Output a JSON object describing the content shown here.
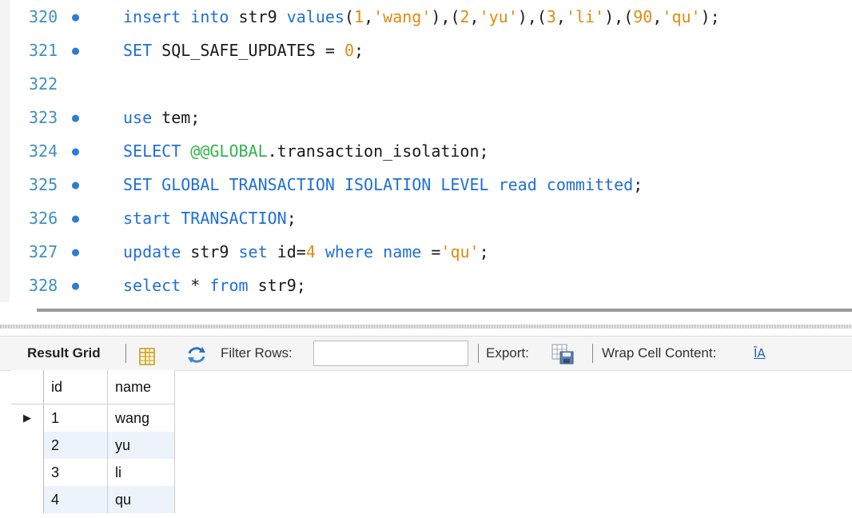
{
  "editor": {
    "lines": [
      {
        "num": "320",
        "marker": true,
        "tokens": [
          {
            "t": "insert",
            "c": "kw"
          },
          {
            "t": " "
          },
          {
            "t": "into",
            "c": "kw"
          },
          {
            "t": " str9 "
          },
          {
            "t": "values",
            "c": "kw"
          },
          {
            "t": "("
          },
          {
            "t": "1",
            "c": "num"
          },
          {
            "t": ","
          },
          {
            "t": "'wang'",
            "c": "str"
          },
          {
            "t": "),("
          },
          {
            "t": "2",
            "c": "num"
          },
          {
            "t": ","
          },
          {
            "t": "'yu'",
            "c": "str"
          },
          {
            "t": "),("
          },
          {
            "t": "3",
            "c": "num"
          },
          {
            "t": ","
          },
          {
            "t": "'li'",
            "c": "str"
          },
          {
            "t": "),("
          },
          {
            "t": "90",
            "c": "num"
          },
          {
            "t": ","
          },
          {
            "t": "'qu'",
            "c": "str"
          },
          {
            "t": ");"
          }
        ]
      },
      {
        "num": "321",
        "marker": true,
        "tokens": [
          {
            "t": "SET",
            "c": "kw"
          },
          {
            "t": " SQL_SAFE_UPDATES = "
          },
          {
            "t": "0",
            "c": "num"
          },
          {
            "t": ";"
          }
        ]
      },
      {
        "num": "322",
        "marker": false,
        "tokens": []
      },
      {
        "num": "323",
        "marker": true,
        "tokens": [
          {
            "t": "use",
            "c": "kw"
          },
          {
            "t": " tem;"
          }
        ]
      },
      {
        "num": "324",
        "marker": true,
        "tokens": [
          {
            "t": "SELECT",
            "c": "kw"
          },
          {
            "t": " "
          },
          {
            "t": "@@GLOBAL",
            "c": "sysvar"
          },
          {
            "t": ".transaction_isolation;"
          }
        ]
      },
      {
        "num": "325",
        "marker": true,
        "tokens": [
          {
            "t": "SET GLOBAL TRANSACTION ISOLATION LEVEL read committed",
            "c": "kw"
          },
          {
            "t": ";"
          }
        ]
      },
      {
        "num": "326",
        "marker": true,
        "tokens": [
          {
            "t": "start",
            "c": "kw"
          },
          {
            "t": " "
          },
          {
            "t": "TRANSACTION",
            "c": "kw"
          },
          {
            "t": ";"
          }
        ]
      },
      {
        "num": "327",
        "marker": true,
        "tokens": [
          {
            "t": "update",
            "c": "kw"
          },
          {
            "t": " str9 "
          },
          {
            "t": "set",
            "c": "kw"
          },
          {
            "t": " id="
          },
          {
            "t": "4",
            "c": "num"
          },
          {
            "t": " "
          },
          {
            "t": "where",
            "c": "kw"
          },
          {
            "t": " "
          },
          {
            "t": "name",
            "c": "kw"
          },
          {
            "t": " ="
          },
          {
            "t": "'qu'",
            "c": "str"
          },
          {
            "t": ";"
          }
        ]
      },
      {
        "num": "328",
        "marker": true,
        "tokens": [
          {
            "t": "select",
            "c": "kw"
          },
          {
            "t": " * "
          },
          {
            "t": "from",
            "c": "kw"
          },
          {
            "t": " str9;"
          }
        ]
      }
    ]
  },
  "toolbar": {
    "result_grid_label": "Result Grid",
    "filter_label": "Filter Rows:",
    "filter_value": "",
    "export_label": "Export:",
    "wrap_label": "Wrap Cell Content:",
    "wrap_icon_glyph": "ĪA"
  },
  "results": {
    "columns": [
      "id",
      "name"
    ],
    "current_row_marker": "▶",
    "rows": [
      {
        "id": "1",
        "name": "wang"
      },
      {
        "id": "2",
        "name": "yu"
      },
      {
        "id": "3",
        "name": "li"
      },
      {
        "id": "4",
        "name": "qu"
      }
    ]
  },
  "colors": {
    "keyword": "#1f6fd6",
    "string": "#e08a10",
    "number": "#e08a10",
    "sysvar": "#33b24b",
    "line_number": "#3f8fbf",
    "alt_row": "#edf3fb"
  }
}
